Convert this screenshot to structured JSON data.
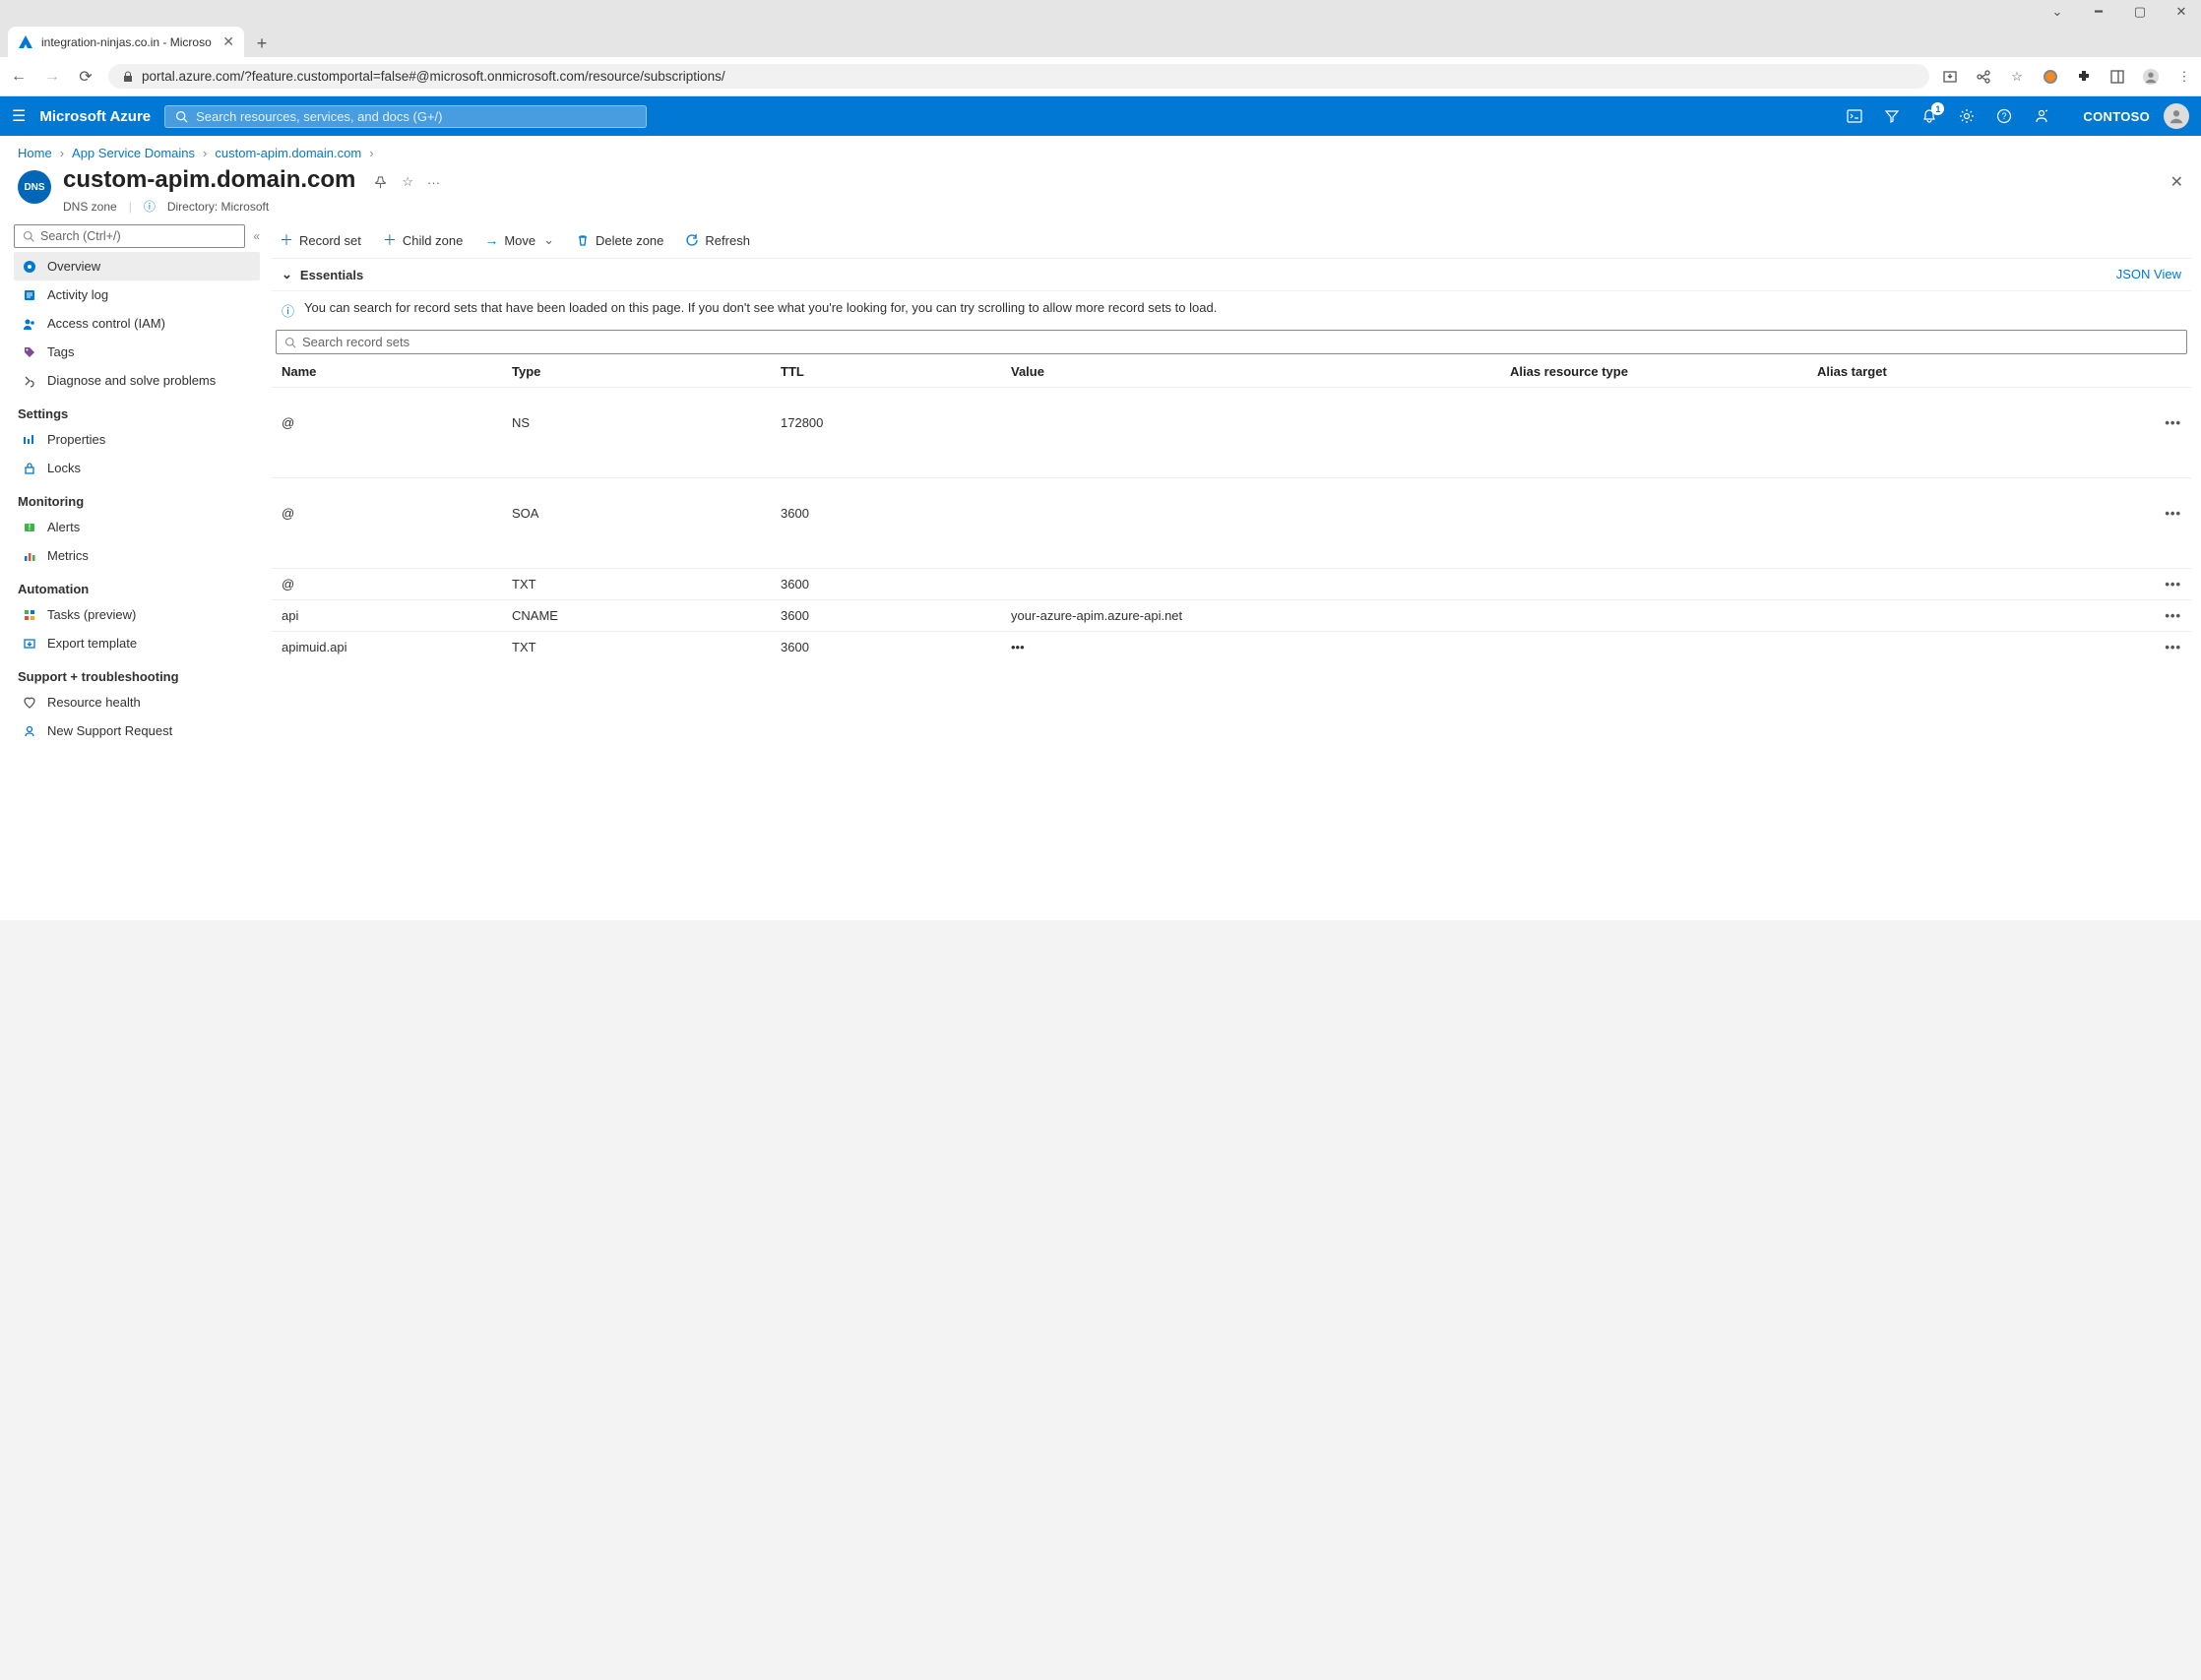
{
  "browser": {
    "tab_title": "integration-ninjas.co.in - Microso",
    "url": "portal.azure.com/?feature.customportal=false#@microsoft.onmicrosoft.com/resource/subscriptions/"
  },
  "azure": {
    "brand": "Microsoft Azure",
    "search_placeholder": "Search resources, services, and docs (G+/)",
    "notification_count": "1",
    "tenant": "CONTOSO"
  },
  "breadcrumb": {
    "home": "Home",
    "level1": "App Service Domains",
    "level2": "custom-apim.domain.com"
  },
  "page": {
    "title": "custom-apim.domain.com",
    "subtitle": "DNS zone",
    "directory_label": "Directory: Microsoft"
  },
  "sidebar": {
    "search_placeholder": "Search (Ctrl+/)",
    "items": {
      "overview": "Overview",
      "activity_log": "Activity log",
      "iam": "Access control (IAM)",
      "tags": "Tags",
      "diagnose": "Diagnose and solve problems"
    },
    "sections": {
      "settings": "Settings",
      "monitoring": "Monitoring",
      "automation": "Automation",
      "support": "Support + troubleshooting"
    },
    "settings": {
      "properties": "Properties",
      "locks": "Locks"
    },
    "monitoring": {
      "alerts": "Alerts",
      "metrics": "Metrics"
    },
    "automation": {
      "tasks": "Tasks (preview)",
      "export": "Export template"
    },
    "support": {
      "resource_health": "Resource health",
      "new_request": "New Support Request"
    }
  },
  "toolbar": {
    "record_set": "Record set",
    "child_zone": "Child zone",
    "move": "Move",
    "delete_zone": "Delete zone",
    "refresh": "Refresh"
  },
  "essentials": {
    "label": "Essentials",
    "json_view": "JSON View"
  },
  "info_text": "You can search for record sets that have been loaded on this page. If you don't see what you're looking for, you can try scrolling to allow more record sets to load.",
  "record_search_placeholder": "Search record sets",
  "columns": {
    "name": "Name",
    "type": "Type",
    "ttl": "TTL",
    "value": "Value",
    "alias_type": "Alias resource type",
    "alias_target": "Alias target"
  },
  "records": [
    {
      "name": "@",
      "type": "NS",
      "ttl": "172800",
      "value": "",
      "tall": true
    },
    {
      "name": "@",
      "type": "SOA",
      "ttl": "3600",
      "value": "",
      "tall": true
    },
    {
      "name": "@",
      "type": "TXT",
      "ttl": "3600",
      "value": ""
    },
    {
      "name": "api",
      "type": "CNAME",
      "ttl": "3600",
      "value": "your-azure-apim.azure-api.net"
    },
    {
      "name": "apimuid.api",
      "type": "TXT",
      "ttl": "3600",
      "value": "•••"
    }
  ]
}
